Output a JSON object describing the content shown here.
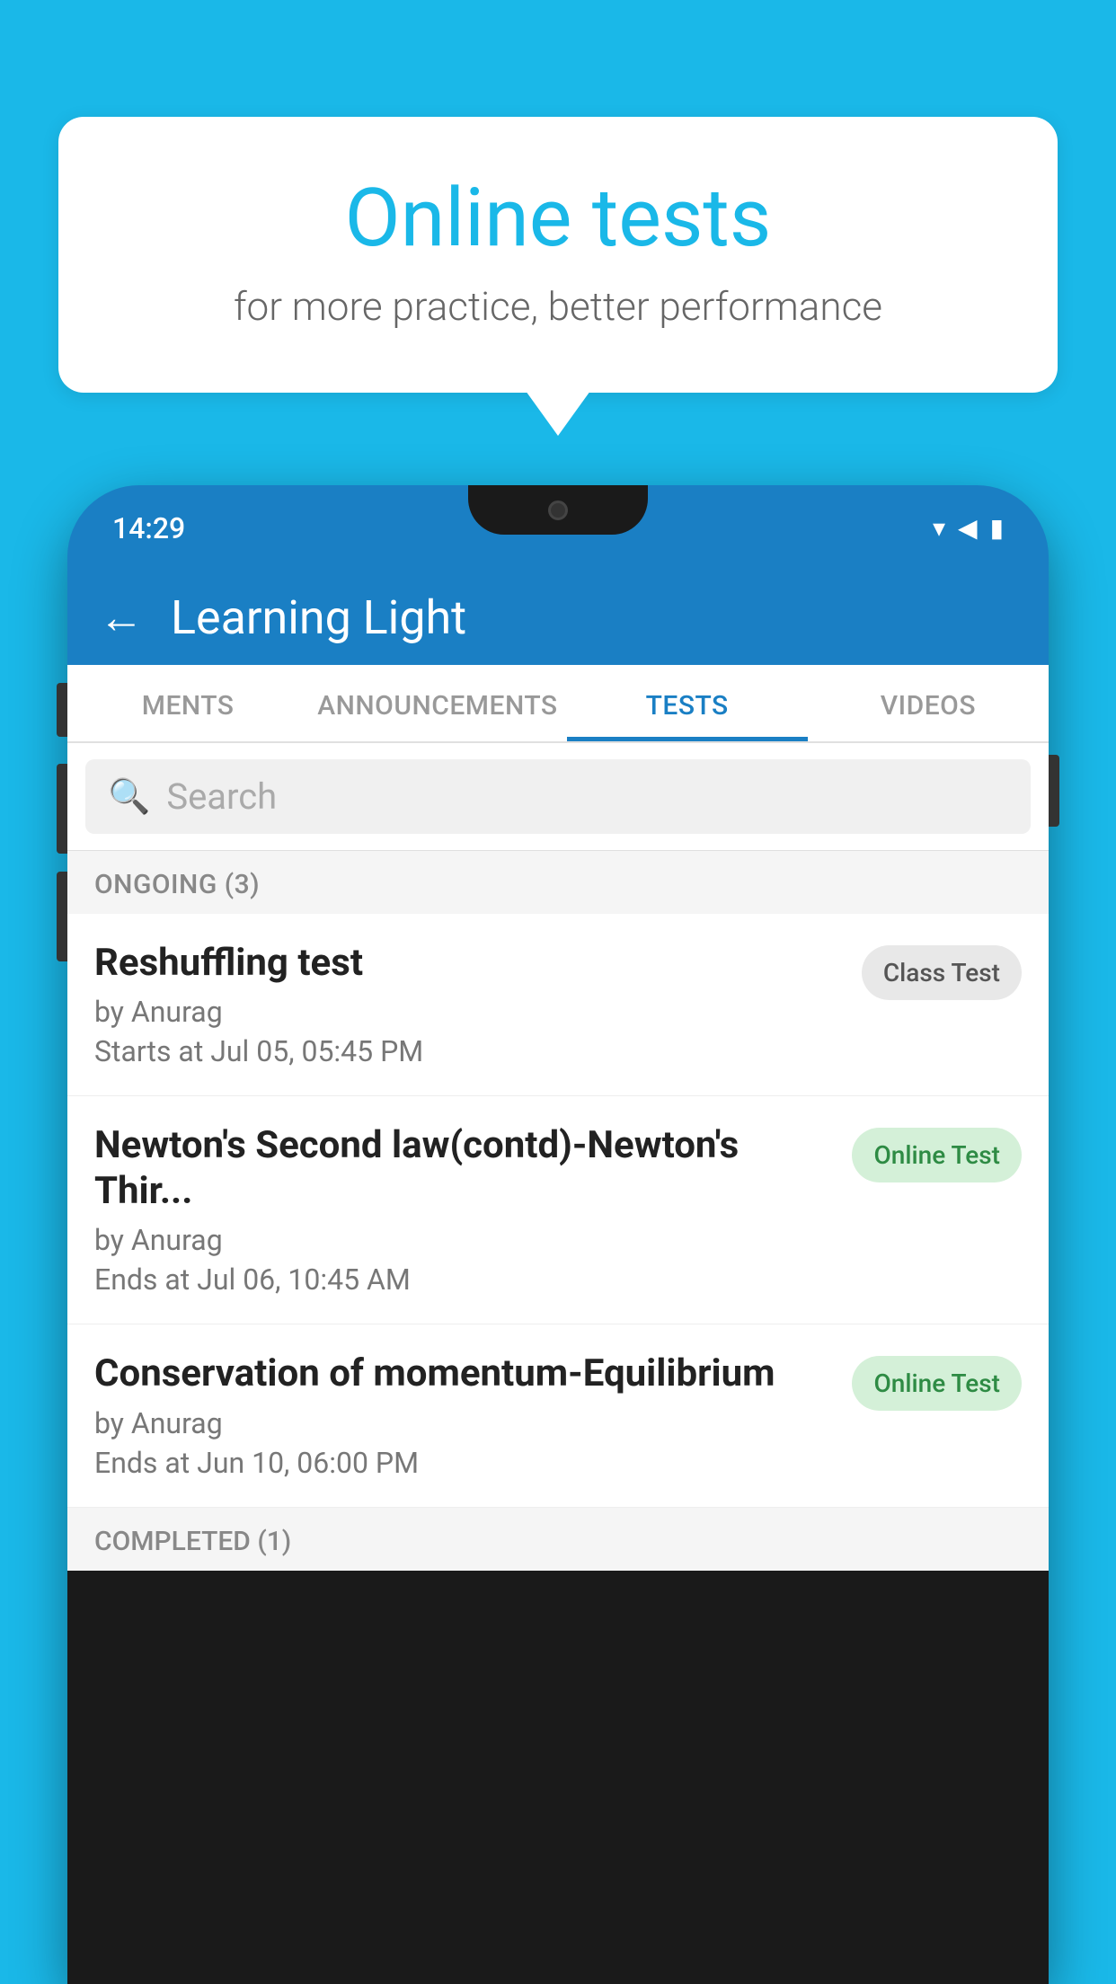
{
  "background_color": "#1ab8e8",
  "speech_bubble": {
    "title": "Online tests",
    "subtitle": "for more practice, better performance"
  },
  "phone": {
    "status_bar": {
      "time": "14:29",
      "icons": [
        "wifi",
        "signal",
        "battery"
      ]
    },
    "app_header": {
      "back_label": "←",
      "title": "Learning Light"
    },
    "tabs": [
      {
        "label": "MENTS",
        "active": false
      },
      {
        "label": "ANNOUNCEMENTS",
        "active": false
      },
      {
        "label": "TESTS",
        "active": true
      },
      {
        "label": "VIDEOS",
        "active": false
      }
    ],
    "search": {
      "placeholder": "Search"
    },
    "ongoing_section": {
      "label": "ONGOING (3)"
    },
    "test_items": [
      {
        "name": "Reshuffling test",
        "by": "by Anurag",
        "time_label": "Starts at",
        "time": "Jul 05, 05:45 PM",
        "badge": "Class Test",
        "badge_type": "class"
      },
      {
        "name": "Newton's Second law(contd)-Newton's Thir...",
        "by": "by Anurag",
        "time_label": "Ends at",
        "time": "Jul 06, 10:45 AM",
        "badge": "Online Test",
        "badge_type": "online"
      },
      {
        "name": "Conservation of momentum-Equilibrium",
        "by": "by Anurag",
        "time_label": "Ends at",
        "time": "Jun 10, 06:00 PM",
        "badge": "Online Test",
        "badge_type": "online"
      }
    ],
    "completed_section": {
      "label": "COMPLETED (1)"
    }
  }
}
